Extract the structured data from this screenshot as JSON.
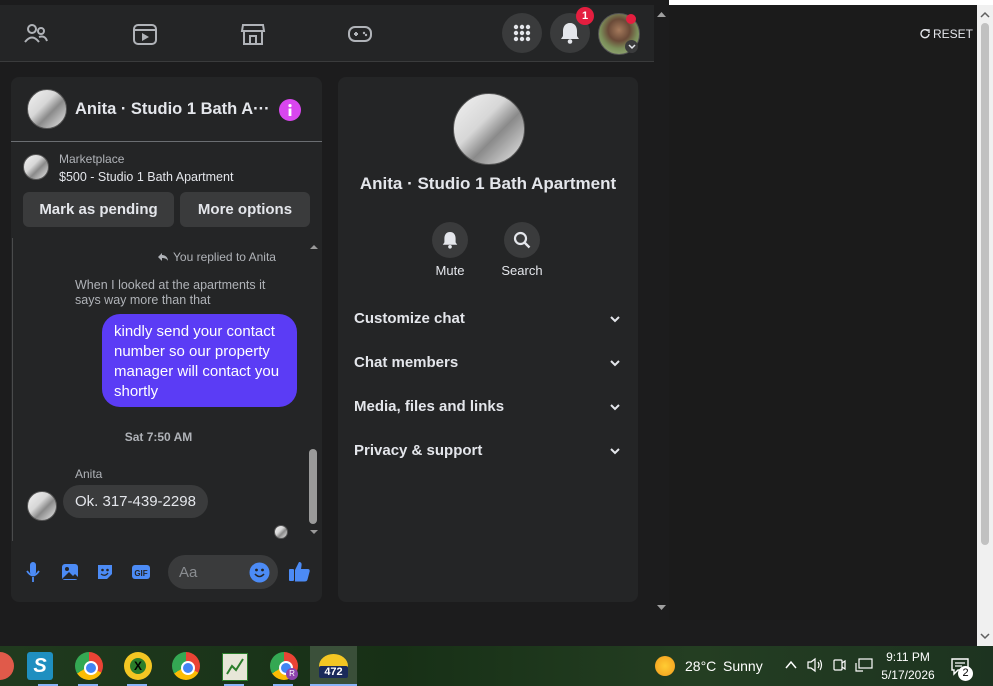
{
  "top_nav": {
    "notification_count": "1",
    "icons": [
      "friends-icon",
      "watch-icon",
      "marketplace-icon",
      "gaming-icon",
      "menu-grid-icon",
      "bell-icon",
      "profile-avatar"
    ]
  },
  "reset": {
    "label": "RESET"
  },
  "chat": {
    "title": "Anita · Studio 1 Bath A···",
    "marketplace_label": "Marketplace",
    "listing": "$500 - Studio 1 Bath Apartment",
    "mark_pending": "Mark as pending",
    "more_options": "More options",
    "replied_note": "You replied to Anita",
    "quoted_message": "When I looked at the apartments it says way more than that",
    "outgoing_message": "kindly send your contact number so our property manager will contact you shortly",
    "timestamp": "Sat 7:50 AM",
    "sender_name": "Anita",
    "incoming_message": "Ok. 317-439-2298",
    "composer_placeholder": "Aa"
  },
  "info_panel": {
    "title": "Anita · Studio 1 Bath Apartment",
    "mute_label": "Mute",
    "search_label": "Search",
    "sections": [
      "Customize chat",
      "Chat members",
      "Media, files and links",
      "Privacy & support"
    ]
  },
  "taskbar": {
    "badge_count": "472",
    "weather_temp": "28°C",
    "weather_text": "Sunny",
    "time": "9:11 PM",
    "date": "5/17/2026",
    "notification_count": "2"
  },
  "colors": {
    "accent": "#0866ff",
    "outgoing_bubble": "#5b3cf5",
    "badge_red": "#e41e3f",
    "info_purple": "#d946ef"
  }
}
